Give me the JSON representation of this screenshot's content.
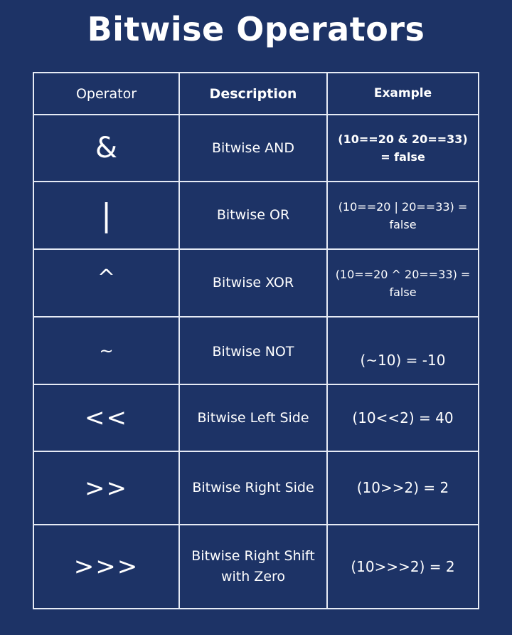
{
  "title": "Bitwise Operators",
  "table": {
    "headers": {
      "operator": "Operator",
      "description": "Description",
      "example": "Example"
    },
    "rows": [
      {
        "operator": "&",
        "description": "Bitwise AND",
        "example": "(10==20 & 20==33) = false"
      },
      {
        "operator": "|",
        "description": "Bitwise OR",
        "example": "(10==20 | 20==33) = false"
      },
      {
        "operator": "^",
        "description": "Bitwise XOR",
        "example": "(10==20 ^ 20==33) = false"
      },
      {
        "operator": "~",
        "description": "Bitwise NOT",
        "example": "(~10) = -10"
      },
      {
        "operator": "<<",
        "description": "Bitwise Left Side",
        "example": "(10<<2) = 40"
      },
      {
        "operator": ">>",
        "description": "Bitwise Right Side",
        "example": "(10>>2) = 2"
      },
      {
        "operator": ">>>",
        "description": "Bitwise Right Shift with Zero",
        "example": "(10>>>2) = 2"
      }
    ]
  }
}
